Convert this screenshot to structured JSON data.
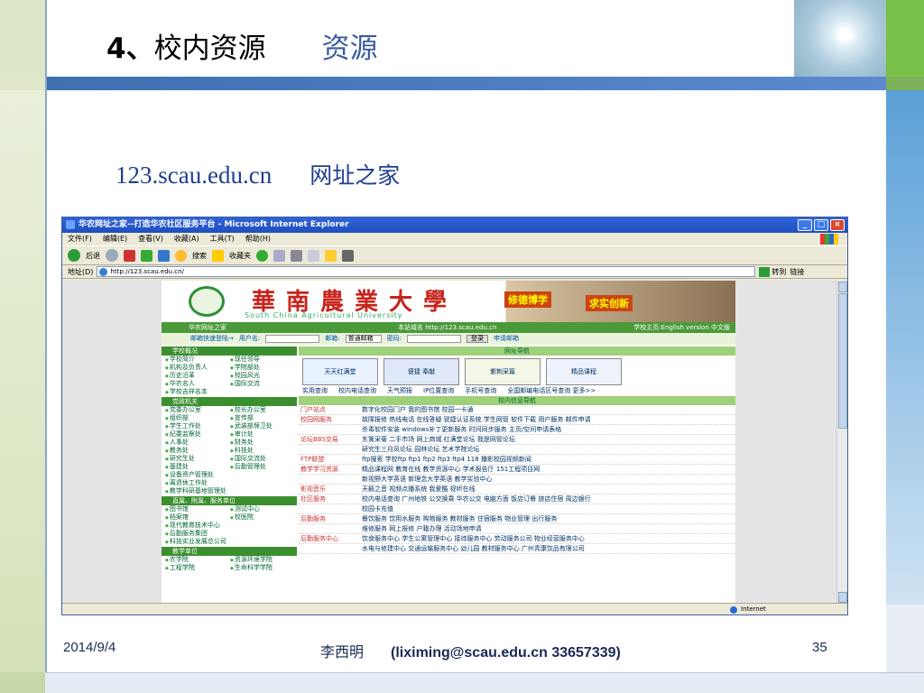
{
  "slide": {
    "title_main": "4、",
    "title_main2": "校内资源",
    "title_sub": "资源",
    "url": "123.scau.edu.cn",
    "url_desc": "网址之家",
    "footer_date": "2014/9/4",
    "footer_author": "李西明",
    "footer_contact": "(liximing@scau.edu.cn  33657339)",
    "page_number": "35"
  },
  "browser": {
    "title": "华农网址之家--打造华农社区服务平台 - Microsoft Internet Explorer",
    "menu": [
      "文件(F)",
      "编辑(E)",
      "查看(V)",
      "收藏(A)",
      "工具(T)",
      "帮助(H)"
    ],
    "toolbar": {
      "back": "后退",
      "search": "搜索",
      "favorites": "收藏夹"
    },
    "address_label": "地址(D)",
    "address_value": "http://123.scau.edu.cn/",
    "go_label": "转到",
    "links_label": "链接",
    "status_zone": "Internet"
  },
  "site": {
    "name": "華南農業大學",
    "name_en": "South China Agricultural University",
    "motto1": "修德博学",
    "motto2": "求实创新",
    "nav_left": "华农网址之家",
    "nav_mid": "本站域名 http://123.scau.edu.cn",
    "nav_right": "学校主页:English version 中文版",
    "login": {
      "quick": "邮箱快速登陆→",
      "user_label": "用户名:",
      "mail_label": "邮箱:",
      "mail_type": "普通邮箱",
      "pwd_label": "密码:",
      "login_btn": "登录",
      "apply": "申请邮箱"
    },
    "left_sections": [
      {
        "head": "学校概况",
        "rows": [
          [
            "学校简介",
            "现任领导"
          ],
          [
            "机构及负责人",
            "学院部处"
          ],
          [
            "历史沿革",
            "校园风光"
          ],
          [
            "华农名人",
            "国际交流"
          ],
          [
            "学校吉祥名本",
            ""
          ]
        ]
      },
      {
        "head": "党政机关",
        "rows": [
          [
            "党委办公室",
            "校长办公室"
          ],
          [
            "组织部",
            "宣传部"
          ],
          [
            "学生工作处",
            "武装部保卫处"
          ],
          [
            "纪委监察处",
            "审计处"
          ],
          [
            "人事处",
            "财务处"
          ],
          [
            "教务处",
            "科技处"
          ],
          [
            "研究生处",
            "国际交流处"
          ],
          [
            "基建处",
            "后勤管理处"
          ],
          [
            "设备资产管理处",
            ""
          ],
          [
            "离退休工作处",
            ""
          ],
          [
            "教学科研基地管理处",
            ""
          ]
        ]
      },
      {
        "head": "直属、附属、服务单位",
        "rows": [
          [
            "图书馆",
            "测试中心"
          ],
          [
            "档案馆",
            "校医院"
          ],
          [
            "现代教育技术中心",
            ""
          ],
          [
            "后勤服务集团",
            ""
          ],
          [
            "科技实业发展总公司",
            ""
          ]
        ]
      },
      {
        "head": "教学单位",
        "rows": [
          [
            "农学院",
            "资源环境学院"
          ],
          [
            "工程学院",
            "生命科学学院"
          ]
        ]
      }
    ],
    "main_head": "网址导航",
    "banners": [
      "天天红满堂",
      "便捷 奉献",
      "紫荆采篇",
      "精品课程"
    ],
    "quick_links": [
      "实用查询",
      "校内电话查询",
      "天气预报",
      "IP位置查询",
      "手机号查询",
      "全国邮编电话区号查询 更多>>"
    ],
    "services_head": "校内信息导航",
    "services": [
      {
        "cat": "门户站点",
        "items": "数字化校园门户   我的图书馆   校园一卡通"
      },
      {
        "cat": "校园网服务",
        "items": "故障报修   热线电话   在线答疑   锐捷认证系统   学生网管  软件下载  用户服务  邮件申请"
      },
      {
        "cat": "",
        "items": "杀毒软件安装   windows补丁更新服务   时间同步服务   主页/空间申请表格"
      },
      {
        "cat": "论坛BBS交易",
        "items": "东篱采菊   二手市场   网上商城   红满堂论坛   我是网管论坛"
      },
      {
        "cat": "",
        "items": "研究生三月风论坛   园林论坛   艺术学院论坛"
      },
      {
        "cat": "FTP联盟",
        "items": "ftp搜索   学校ftp   ftp1   ftp2   ftp3   ftp4   118   播影校园视频新闻"
      },
      {
        "cat": "教学学习资源",
        "items": "精品课程网   教育在线   教学资源中心   学术报告厅   151工程项目网"
      },
      {
        "cat": "",
        "items": "新视野大学英语   新理念大学英语   教学实验中心"
      },
      {
        "cat": "影视音乐",
        "items": "天籁之音  视频点播系统  我爱酷  视听在线"
      },
      {
        "cat": "社区服务",
        "items": "校内电话查询  广州地铁  公交换乘  华农公交   电脑方面  饭店订餐  旅店住宿  周边银行"
      },
      {
        "cat": "",
        "items": "校园卡充值"
      },
      {
        "cat": "后勤服务",
        "items": "餐饮服务   饮用水服务   购物服务   教材服务   住宿服务   物业管理   出行服务"
      },
      {
        "cat": "",
        "items": "维修服务   网上报修   户籍办理   活动场地申请"
      },
      {
        "cat": "后勤服务中心",
        "items": "饮食服务中心   学生公寓管理中心   接待服务中心   劳动服务公司   物业经营服务中心"
      },
      {
        "cat": "",
        "items": "水电与修建中心   交通运输服务中心  幼儿园   教材服务中心   广州青康饮品有限公司"
      }
    ]
  }
}
